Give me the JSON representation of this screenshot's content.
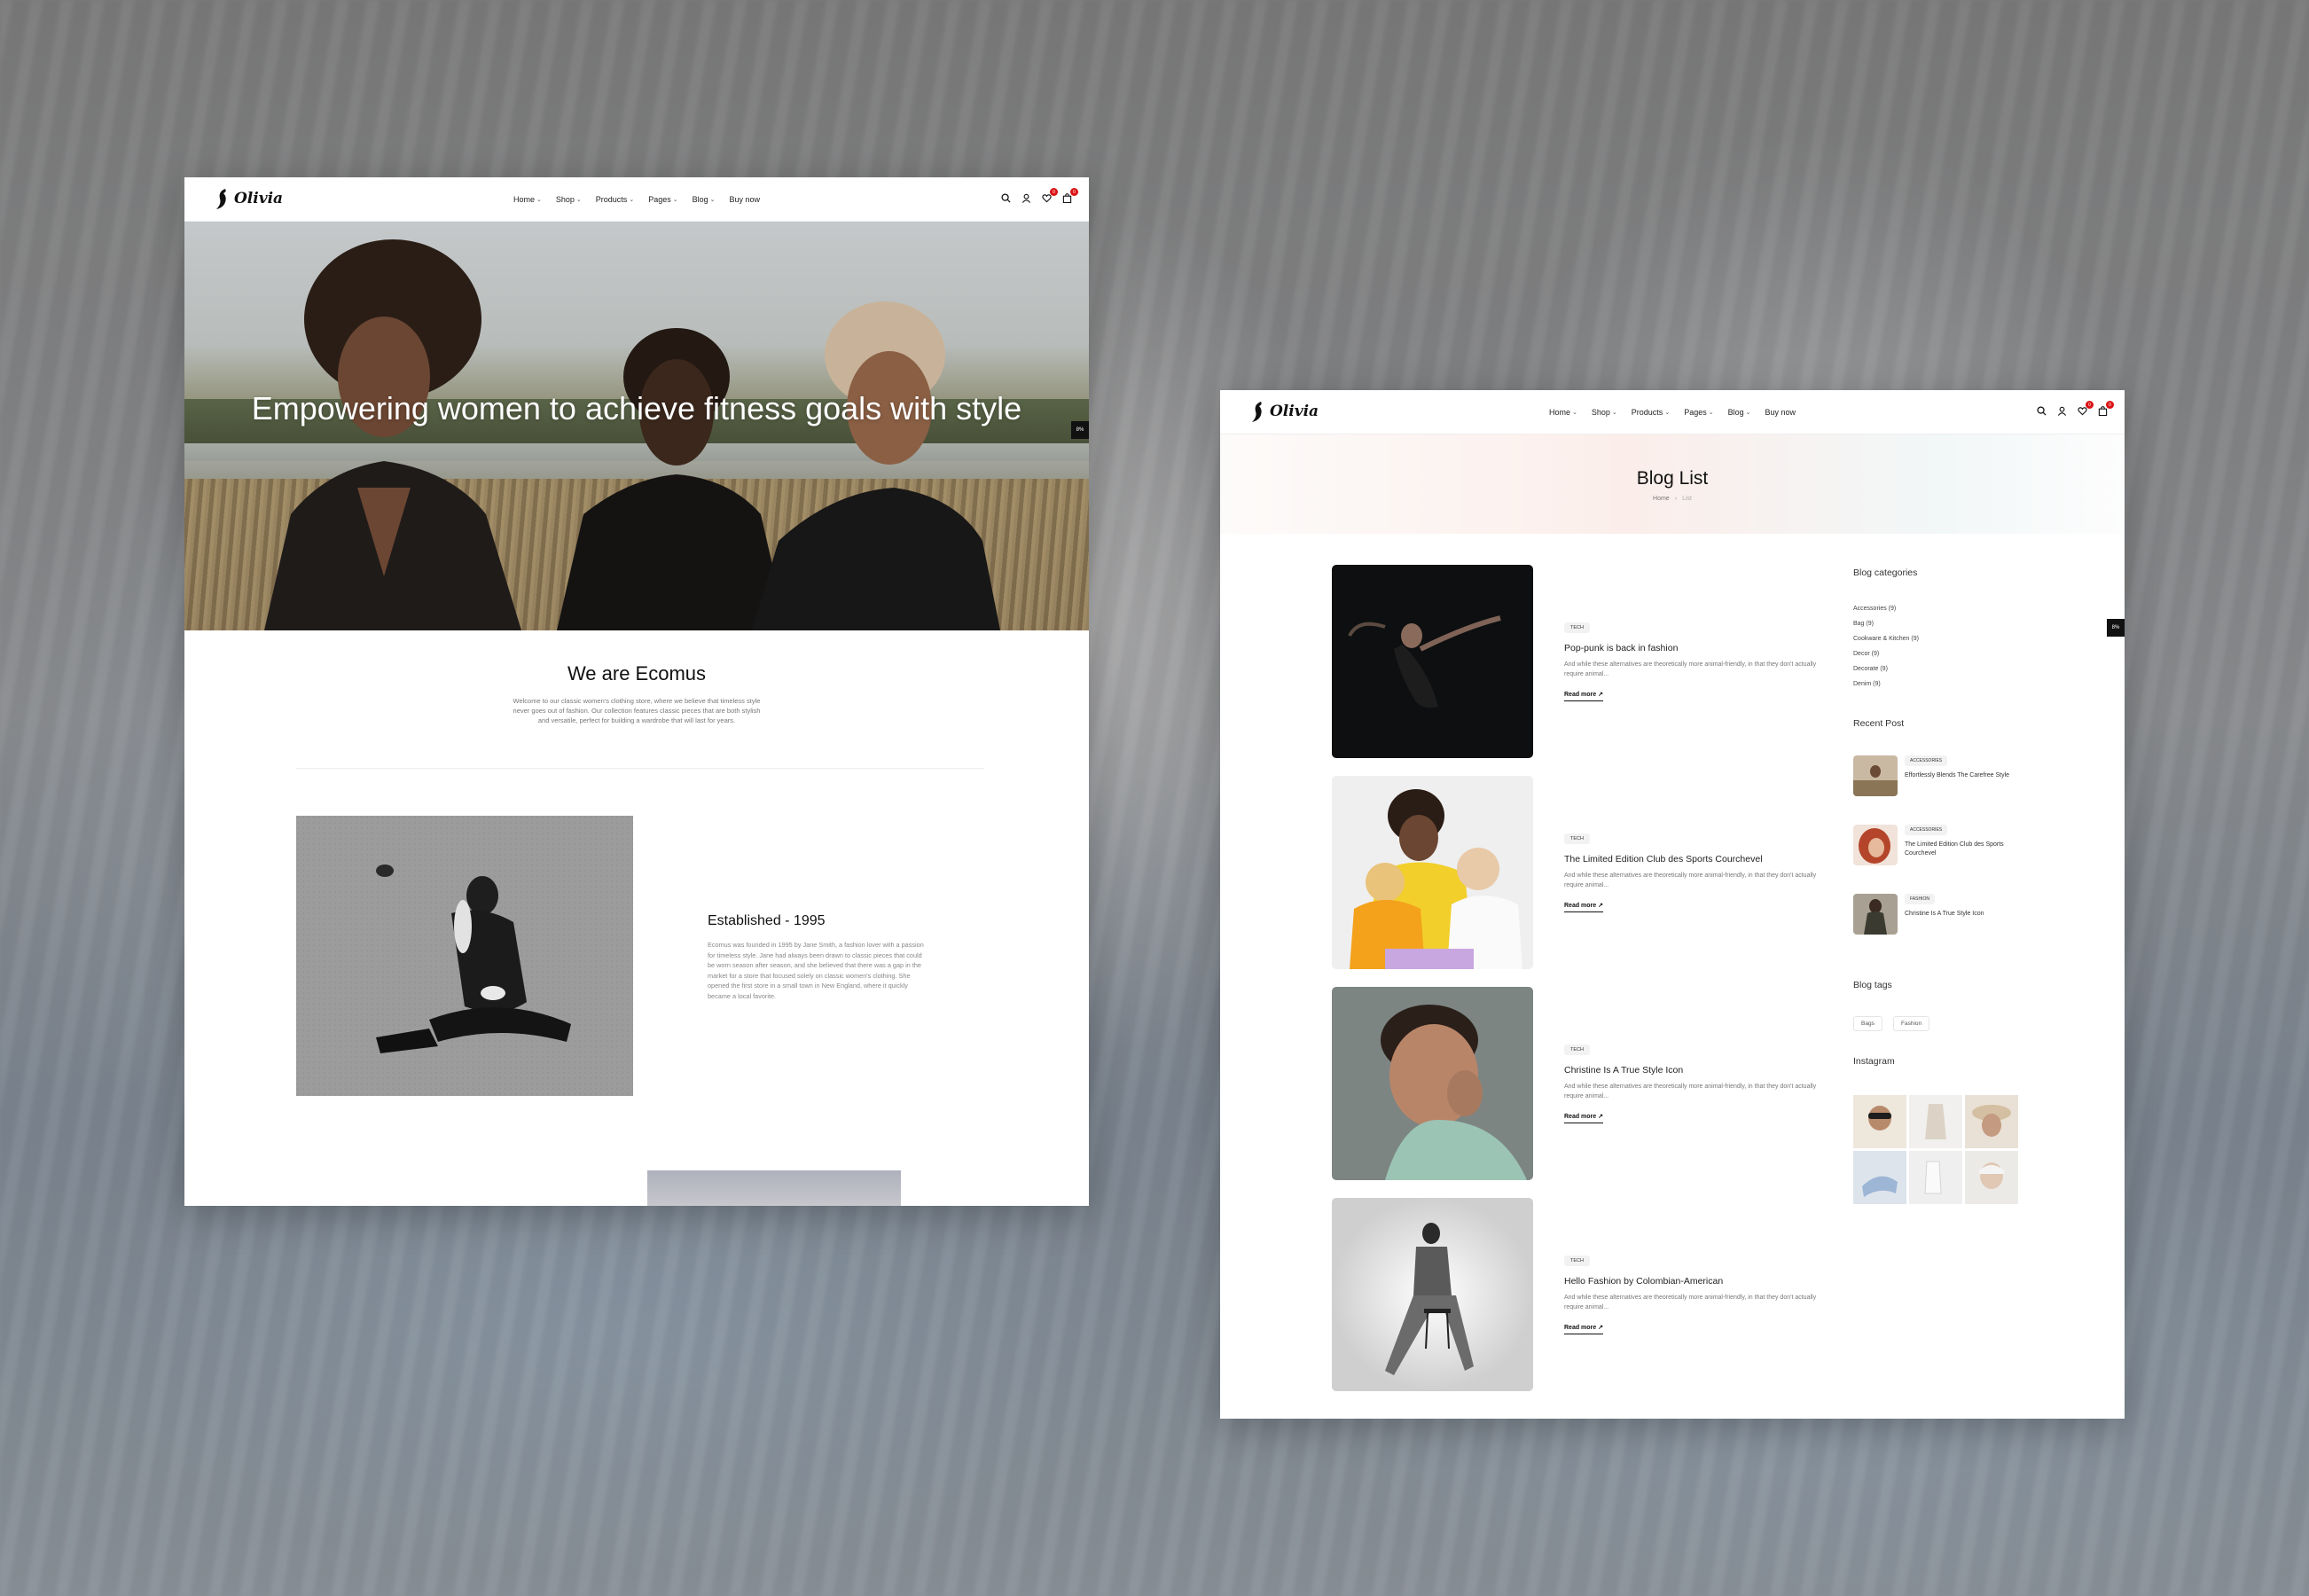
{
  "left_page": {
    "nav": {
      "logo_text": "Olivia",
      "menu": [
        "Home",
        "Shop",
        "Products",
        "Pages",
        "Blog",
        "Buy now"
      ],
      "wishlist_count": "0",
      "cart_count": "0"
    },
    "side_pill": "8%",
    "hero": {
      "title": "Empowering women to achieve fitness goals with style"
    },
    "about": {
      "title": "We are Ecomus",
      "text": "Welcome to our classic women's clothing store, where we believe that timeless style never goes out of fashion. Our collection features classic pieces that are both stylish and versatile, perfect for building a wardrobe that will last for years."
    },
    "established": {
      "title": "Established - 1995",
      "text": "Ecomus was founded in 1995 by Jane Smith, a fashion lover with a passion for timeless style. Jane had always been drawn to classic pieces that could be worn season after season, and she believed that there was a gap in the market for a store that focused solely on classic women's clothing. She opened the first store in a small town in New England, where it quickly became a local favorite."
    }
  },
  "right_page": {
    "nav": {
      "logo_text": "Olivia",
      "menu": [
        "Home",
        "Shop",
        "Products",
        "Pages",
        "Blog",
        "Buy now"
      ],
      "wishlist_count": "0",
      "cart_count": "0"
    },
    "side_pill": "8%",
    "banner": {
      "title": "Blog List",
      "crumb_home": "Home",
      "crumb_current": "List"
    },
    "posts": [
      {
        "tag": "TECH",
        "title": "Pop-punk is back in fashion",
        "excerpt": "And while these alternatives are theoretically more animal-friendly, in that they don't actually require animal...",
        "more": "Read more"
      },
      {
        "tag": "TECH",
        "title": "The Limited Edition Club des Sports Courchevel",
        "excerpt": "And while these alternatives are theoretically more animal-friendly, in that they don't actually require animal...",
        "more": "Read more"
      },
      {
        "tag": "TECH",
        "title": "Christine Is A True Style Icon",
        "excerpt": "And while these alternatives are theoretically more animal-friendly, in that they don't actually require animal...",
        "more": "Read more"
      },
      {
        "tag": "TECH",
        "title": "Hello Fashion by Colombian-American",
        "excerpt": "And while these alternatives are theoretically more animal-friendly, in that they don't actually require animal...",
        "more": "Read more"
      }
    ],
    "sidebar": {
      "categories_title": "Blog categories",
      "categories": [
        "Accessories (9)",
        "Bag (9)",
        "Cookware & Kitchen (9)",
        "Decor (9)",
        "Decorate (9)",
        "Denim (9)"
      ],
      "recent_title": "Recent Post",
      "recent": [
        {
          "tag": "ACCESSORIES",
          "title": "Effortlessly Blends The Carefree Style"
        },
        {
          "tag": "ACCESSORIES",
          "title": "The Limited Edition Club des Sports Courchevel"
        },
        {
          "tag": "FASHION",
          "title": "Christine Is A True Style Icon"
        }
      ],
      "tags_title": "Blog tags",
      "tags": [
        "Bags",
        "Fashion"
      ],
      "instagram_title": "Instagram"
    }
  }
}
